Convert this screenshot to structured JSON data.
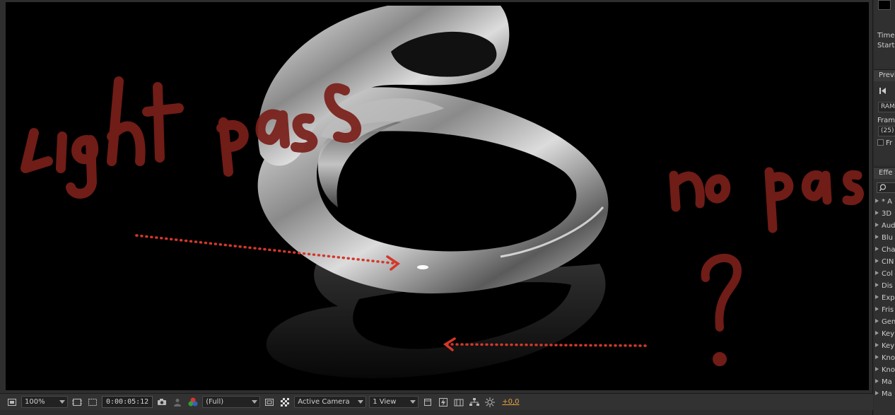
{
  "annotations": {
    "left_text": "Light pass",
    "right_text": "no pass",
    "question_mark": "?"
  },
  "colors": {
    "annotation_red": "#7a1f1a",
    "arrow_red": "#d4372a",
    "exposure_orange": "#e6a23c"
  },
  "toolbar": {
    "magnification": "100%",
    "timecode": "0:00:05:12",
    "resolution": "(Full)",
    "camera": "Active Camera",
    "view_layout": "1 View",
    "exposure": "+0,0"
  },
  "right_panel": {
    "info": {
      "time_label": "Time",
      "start_label": "Start"
    },
    "preview": {
      "title": "Previ",
      "ram_label": "RAM",
      "frame_label": "Fram",
      "frame_value": "(25)",
      "checkbox_label": "Fr"
    },
    "effects": {
      "title": "Effe",
      "search_icon": "search-icon",
      "items": [
        "* A",
        "3D",
        "Aud",
        "Blu",
        "Cha",
        "CIN",
        "Col",
        "Dis",
        "Exp",
        "Fris",
        "Gen",
        "Key",
        "Key",
        "Kno",
        "Kno",
        "Ma",
        "Ma"
      ]
    }
  }
}
